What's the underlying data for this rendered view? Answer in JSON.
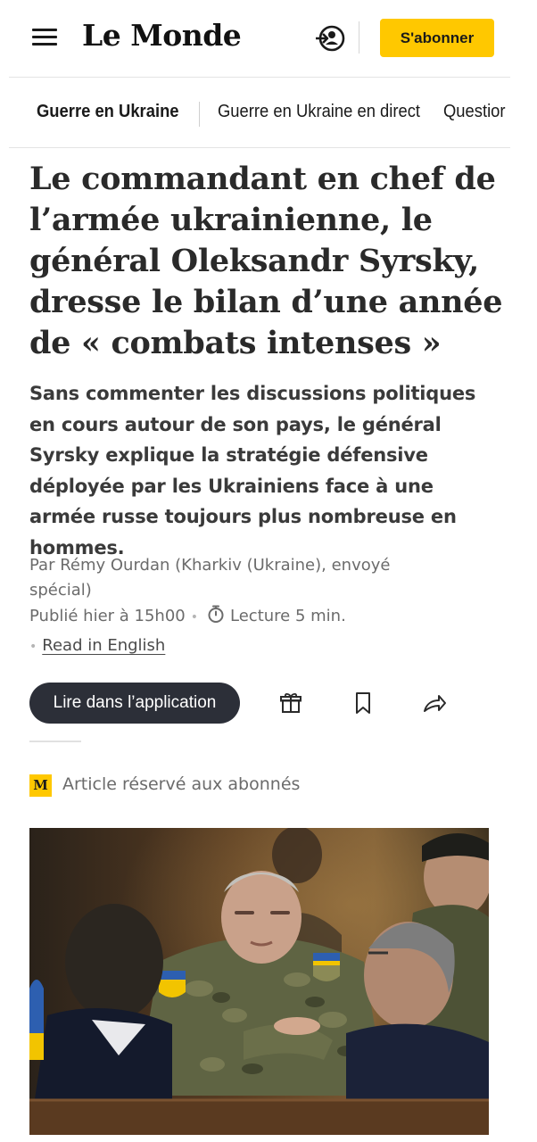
{
  "header": {
    "logo_text": "Le Monde",
    "subscribe_label": "S'abonner",
    "menu_icon": "hamburger-menu-icon",
    "account_icon": "login-user-icon"
  },
  "nav": {
    "items": [
      {
        "label": "Guerre en Ukraine",
        "bold": true
      },
      {
        "label": "Guerre en Ukraine en direct",
        "bold": false
      },
      {
        "label": "Questior",
        "bold": false
      }
    ]
  },
  "article": {
    "headline": "Le commandant en chef de l’armée ukrainienne, le général Oleksandr Syrsky, dresse le bilan d’une année de « combats intenses »",
    "lede": "Sans commenter les discussions politiques en cours autour de son pays, le général Syrsky explique la stratégie défensive déployée par les Ukrainiens face à une armée russe toujours plus nombreuse en hommes.",
    "author_line": "Par Rémy Ourdan (Kharkiv (Ukraine), envoyé spécial)",
    "published": "Publié hier à 15h00",
    "reading_time": "Lecture 5 min.",
    "read_in_english": "Read in English",
    "open_in_app": "Lire dans l’application",
    "premium_badge": "M",
    "premium_label": "Article réservé aux abonnés"
  },
  "actions": {
    "gift_icon": "gift-icon",
    "bookmark_icon": "bookmark-icon",
    "share_icon": "share-arrow-icon"
  },
  "colors": {
    "accent_yellow": "#ffc800",
    "app_button_bg": "#2c2f38",
    "text_main": "#2a2a2a",
    "text_meta": "#6b6b6b"
  }
}
